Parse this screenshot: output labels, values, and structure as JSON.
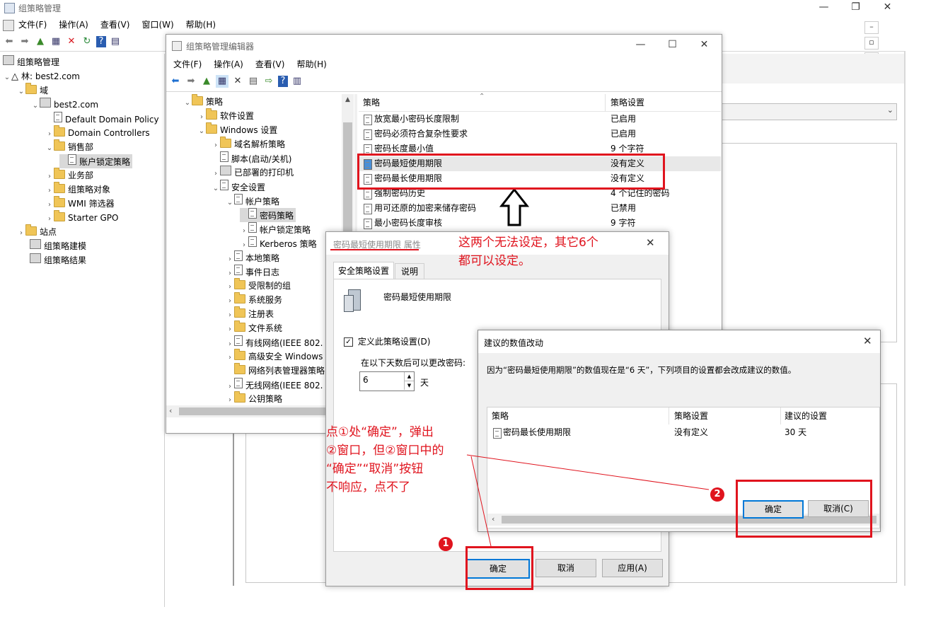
{
  "main": {
    "title": "组策略管理",
    "menu": [
      "文件(F)",
      "操作(A)",
      "查看(V)",
      "窗口(W)",
      "帮助(H)"
    ],
    "tree": [
      {
        "label": "组策略管理"
      },
      {
        "label": "林: best2.com"
      },
      {
        "label": "域"
      },
      {
        "label": "best2.com"
      },
      {
        "label": "Default Domain Policy"
      },
      {
        "label": "Domain Controllers"
      },
      {
        "label": "销售部"
      },
      {
        "label": "账户锁定策略"
      },
      {
        "label": "业务部"
      },
      {
        "label": "组策略对象"
      },
      {
        "label": "WMI 筛选器"
      },
      {
        "label": "Starter GPO"
      },
      {
        "label": "站点"
      },
      {
        "label": "组策略建模"
      },
      {
        "label": "组策略结果"
      }
    ]
  },
  "editor": {
    "title": "组策略管理编辑器",
    "menu": [
      "文件(F)",
      "操作(A)",
      "查看(V)",
      "帮助(H)"
    ],
    "tree": [
      {
        "label": "策略"
      },
      {
        "label": "软件设置"
      },
      {
        "label": "Windows 设置"
      },
      {
        "label": "域名解析策略"
      },
      {
        "label": "脚本(启动/关机)"
      },
      {
        "label": "已部署的打印机"
      },
      {
        "label": "安全设置"
      },
      {
        "label": "帐户策略"
      },
      {
        "label": "密码策略"
      },
      {
        "label": "帐户锁定策略"
      },
      {
        "label": "Kerberos 策略"
      },
      {
        "label": "本地策略"
      },
      {
        "label": "事件日志"
      },
      {
        "label": "受限制的组"
      },
      {
        "label": "系统服务"
      },
      {
        "label": "注册表"
      },
      {
        "label": "文件系统"
      },
      {
        "label": "有线网络(IEEE 802."
      },
      {
        "label": "高级安全 Windows"
      },
      {
        "label": "网络列表管理器策略"
      },
      {
        "label": "无线网络(IEEE 802."
      },
      {
        "label": "公钥策略"
      }
    ],
    "list_headers": {
      "policy": "策略",
      "setting": "策略设置"
    },
    "rows": [
      {
        "policy": "放宽最小密码长度限制",
        "setting": "已启用"
      },
      {
        "policy": "密码必须符合复杂性要求",
        "setting": "已启用"
      },
      {
        "policy": "密码长度最小值",
        "setting": "9 个字符"
      },
      {
        "policy": "密码最短使用期限",
        "setting": "没有定义"
      },
      {
        "policy": "密码最长使用期限",
        "setting": "没有定义"
      },
      {
        "policy": "强制密码历史",
        "setting": "4 个记住的密码"
      },
      {
        "policy": "用可还原的加密来储存密码",
        "setting": "已禁用"
      },
      {
        "policy": "最小密码长度审核",
        "setting": "9 字符"
      }
    ]
  },
  "props_dialog": {
    "title": "密码最短使用期限 属性",
    "tabs": [
      "安全策略设置",
      "说明"
    ],
    "policy_name": "密码最短使用期限",
    "define_label": "定义此策略设置(D)",
    "days_prompt": "在以下天数后可以更改密码:",
    "days_value": "6",
    "days_unit": "天",
    "ok": "确定",
    "cancel": "取消",
    "apply": "应用(A)"
  },
  "suggest_dialog": {
    "title": "建议的数值改动",
    "message": "因为“密码最短使用期限”的数值现在是“6 天”，下列项目的设置都会改成建议的数值。",
    "headers": {
      "policy": "策略",
      "setting": "策略设置",
      "suggested": "建议的设置"
    },
    "row": {
      "policy": "密码最长使用期限",
      "setting": "没有定义",
      "suggested": "30 天"
    },
    "ok": "确定",
    "cancel": "取消(C)"
  },
  "annotations": {
    "note_top_line1": "这两个无法设定，其它6个",
    "note_top_line2": "都可以设定。",
    "note_left_line1": "点①处“确定”，弹出",
    "note_left_line2": "②窗口，但②窗口中的",
    "note_left_line3": "“确定”“取消”按钮",
    "note_left_line4": "不响应，点不了",
    "marker1": "1",
    "marker2": "2"
  },
  "colors": {
    "annotation_red": "#e0141e",
    "accent_blue": "#0078d7"
  }
}
